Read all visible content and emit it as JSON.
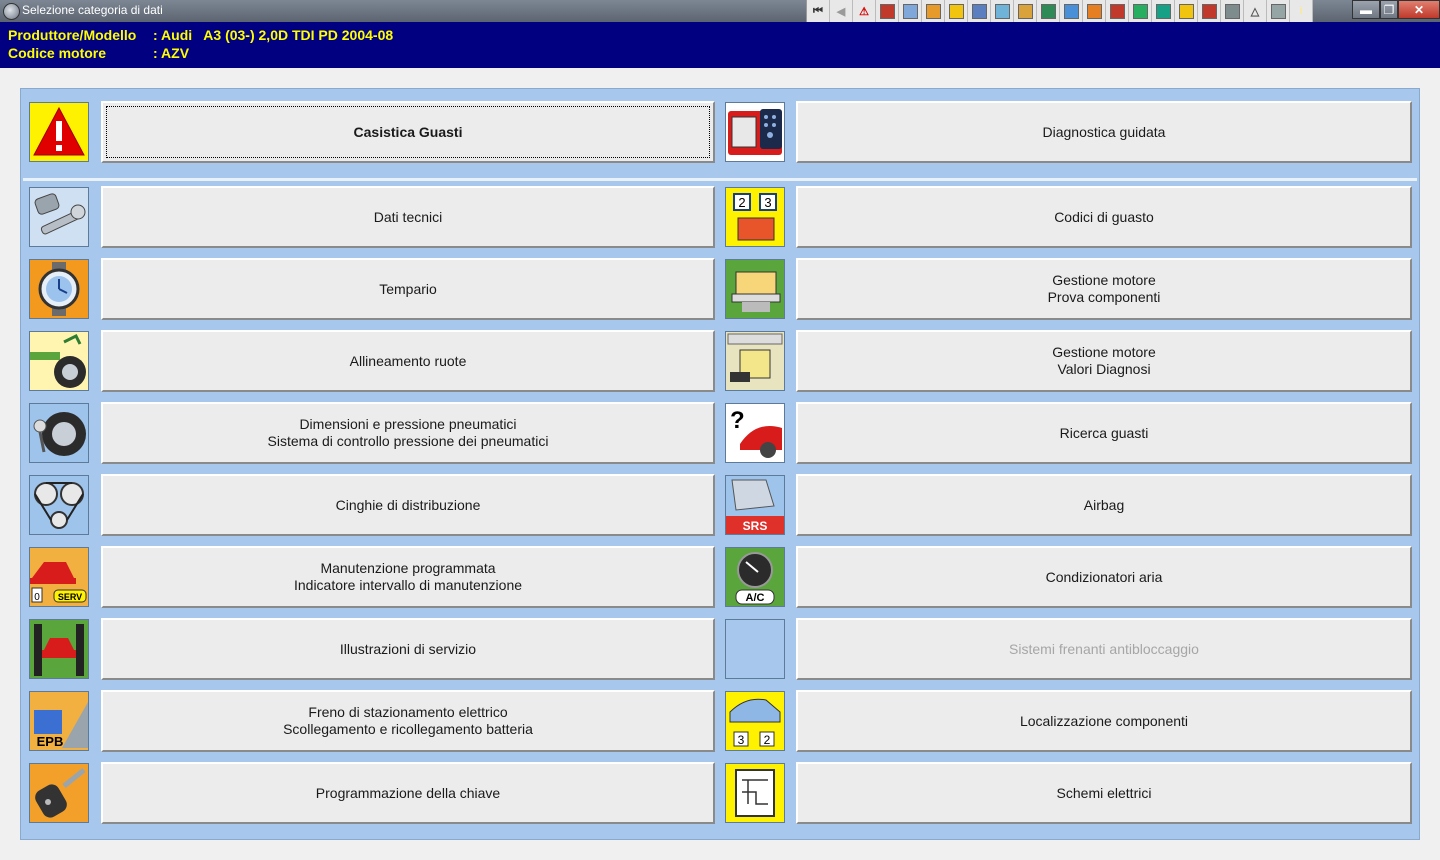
{
  "window": {
    "title": "Selezione categoria di dati"
  },
  "toolbar": {
    "buttons": [
      {
        "name": "first-icon",
        "glyph": "⏮",
        "color": "#333333"
      },
      {
        "name": "back-icon",
        "glyph": "◀",
        "color": "#9a9a9a"
      },
      {
        "name": "warning-icon",
        "glyph": "⚠",
        "color": "#d40000"
      },
      {
        "name": "tester-icon",
        "glyph": "",
        "color": "#c0392b"
      },
      {
        "name": "tech-data-icon",
        "glyph": "",
        "color": "#7fa7d9"
      },
      {
        "name": "gauge-icon",
        "glyph": "",
        "color": "#e59a2a"
      },
      {
        "name": "wrench-icon",
        "glyph": "",
        "color": "#f1c40f"
      },
      {
        "name": "clock-icon",
        "glyph": "",
        "color": "#5b7fbf"
      },
      {
        "name": "tyre-icon",
        "glyph": "",
        "color": "#6fb3d9"
      },
      {
        "name": "belt-icon",
        "glyph": "",
        "color": "#d9a23a"
      },
      {
        "name": "lift-icon",
        "glyph": "",
        "color": "#2e8b57"
      },
      {
        "name": "service-icon",
        "glyph": "",
        "color": "#4a90d9"
      },
      {
        "name": "key-icon",
        "glyph": "",
        "color": "#e67e22"
      },
      {
        "name": "airbag-icon",
        "glyph": "",
        "color": "#c0392b"
      },
      {
        "name": "aircon-icon",
        "glyph": "",
        "color": "#27ae60"
      },
      {
        "name": "diagram-icon",
        "glyph": "",
        "color": "#16a085"
      },
      {
        "name": "fault-icon",
        "glyph": "",
        "color": "#f1c40f"
      },
      {
        "name": "car-icon",
        "glyph": "",
        "color": "#c0392b"
      },
      {
        "name": "disc-icon",
        "glyph": "",
        "color": "#7f8c8d"
      },
      {
        "name": "triangle-icon",
        "glyph": "△",
        "color": "#555555"
      },
      {
        "name": "settings-icon",
        "glyph": "",
        "color": "#95a5a6"
      },
      {
        "name": "info-icon",
        "glyph": "i",
        "color": "#f9e79f"
      }
    ],
    "min_glyph": "▬",
    "max_glyph": "❐",
    "close_glyph": "✕"
  },
  "header": {
    "row1_label": "Produttore/Modello",
    "row1_value": ": Audi   A3 (03-) 2,0D TDI PD 2004-08",
    "row2_label": "Codice motore",
    "row2_value": ": AZV"
  },
  "categories": {
    "top_left": {
      "line1": "Casistica Guasti",
      "line2": ""
    },
    "top_right": {
      "line1": "Diagnostica guidata",
      "line2": ""
    },
    "left": [
      {
        "line1": "Dati tecnici",
        "line2": ""
      },
      {
        "line1": "Tempario",
        "line2": ""
      },
      {
        "line1": "Allineamento ruote",
        "line2": ""
      },
      {
        "line1": "Dimensioni e pressione pneumatici",
        "line2": "Sistema di controllo pressione dei pneumatici"
      },
      {
        "line1": "Cinghie di distribuzione",
        "line2": ""
      },
      {
        "line1": "Manutenzione programmata",
        "line2": "Indicatore intervallo di manutenzione"
      },
      {
        "line1": "Illustrazioni di servizio",
        "line2": ""
      },
      {
        "line1": "Freno di stazionamento elettrico",
        "line2": "Scollegamento e ricollegamento batteria"
      },
      {
        "line1": "Programmazione della chiave",
        "line2": ""
      }
    ],
    "right": [
      {
        "line1": "Codici di guasto",
        "line2": ""
      },
      {
        "line1": "Gestione motore",
        "line2": "Prova componenti"
      },
      {
        "line1": "Gestione motore",
        "line2": "Valori Diagnosi"
      },
      {
        "line1": "Ricerca guasti",
        "line2": ""
      },
      {
        "line1": "Airbag",
        "line2": ""
      },
      {
        "line1": "Condizionatori aria",
        "line2": ""
      },
      {
        "line1": "Sistemi frenanti antibloccaggio",
        "line2": ""
      },
      {
        "line1": "Localizzazione componenti",
        "line2": ""
      },
      {
        "line1": "Schemi elettrici",
        "line2": ""
      }
    ]
  },
  "icon_labels": {
    "fault_codes_a": "2",
    "fault_codes_b": "3",
    "srs": "SRS",
    "ac": "A/C",
    "epb": "EPB",
    "serv": "SERV",
    "serv_zero": "0",
    "loc_a": "3",
    "loc_b": "2"
  }
}
